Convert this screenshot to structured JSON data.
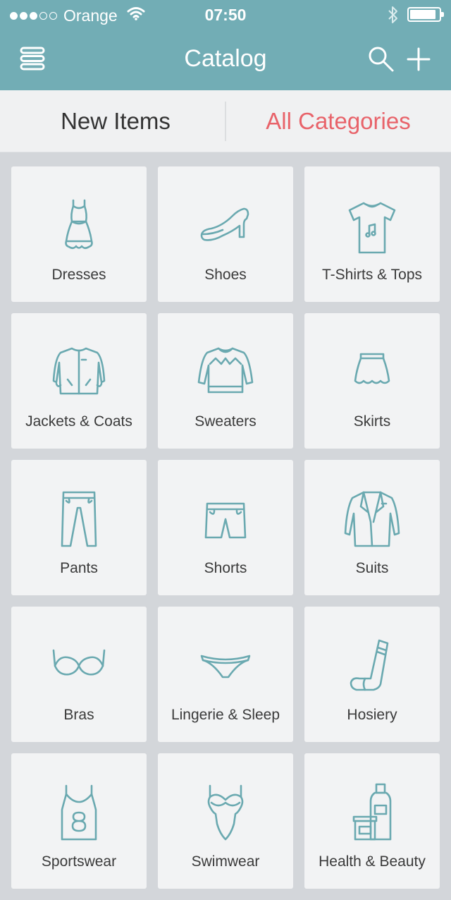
{
  "status_bar": {
    "carrier": "Orange",
    "time": "07:50",
    "signal_bars": 3,
    "signal_max": 5,
    "battery_level": 0.9
  },
  "navbar": {
    "title": "Catalog",
    "menu_icon": "menu-icon",
    "search_icon": "search-icon",
    "add_icon": "plus-icon"
  },
  "segments": {
    "left_label": "New Items",
    "right_label": "All Categories",
    "active": "right",
    "active_color": "#e8636a"
  },
  "colors": {
    "header": "#72adb5",
    "icon_stroke": "#6aa9b0",
    "tile_bg": "#f2f3f4",
    "page_bg": "#d3d6da"
  },
  "categories": [
    {
      "label": "Dresses",
      "icon": "dress-icon"
    },
    {
      "label": "Shoes",
      "icon": "shoe-icon"
    },
    {
      "label": "T-Shirts & Tops",
      "icon": "tshirt-icon"
    },
    {
      "label": "Jackets & Coats",
      "icon": "jacket-icon"
    },
    {
      "label": "Sweaters",
      "icon": "sweater-icon"
    },
    {
      "label": "Skirts",
      "icon": "skirt-icon"
    },
    {
      "label": "Pants",
      "icon": "pants-icon"
    },
    {
      "label": "Shorts",
      "icon": "shorts-icon"
    },
    {
      "label": "Suits",
      "icon": "suit-icon"
    },
    {
      "label": "Bras",
      "icon": "bra-icon"
    },
    {
      "label": "Lingerie & Sleep",
      "icon": "lingerie-icon"
    },
    {
      "label": "Hosiery",
      "icon": "sock-icon"
    },
    {
      "label": "Sportswear",
      "icon": "tank-top-icon"
    },
    {
      "label": "Swimwear",
      "icon": "swimsuit-icon"
    },
    {
      "label": "Health & Beauty",
      "icon": "cosmetics-icon"
    }
  ]
}
